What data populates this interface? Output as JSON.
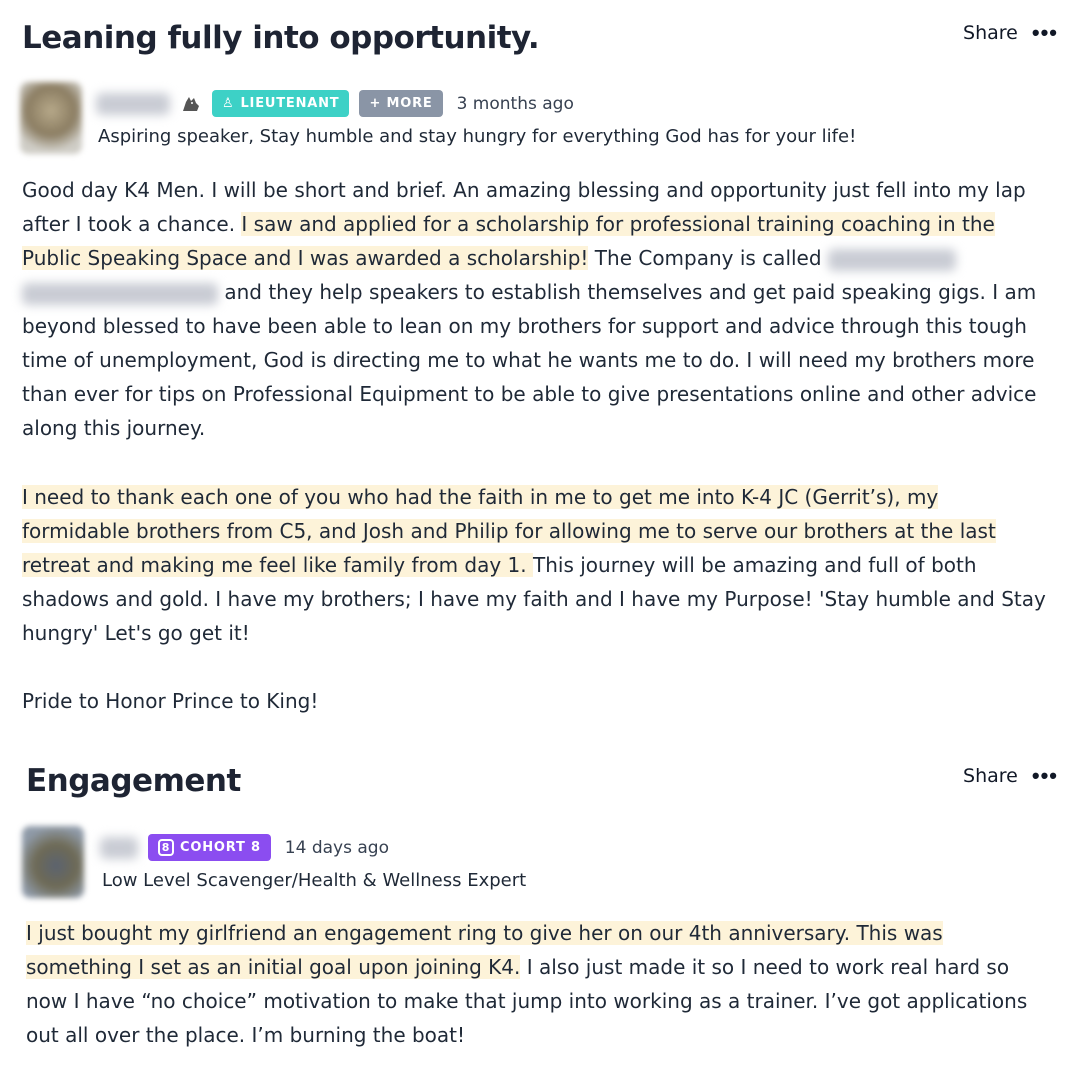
{
  "post1": {
    "title": "Leaning fully into opportunity.",
    "share_label": "Share",
    "more_label": "•••",
    "author": {
      "badge_primary": "LIEUTENANT",
      "badge_more": "+ MORE",
      "timestamp": "3 months ago",
      "tagline": "Aspiring speaker, Stay humble and stay hungry for everything God has for your life!"
    },
    "body": {
      "p1_a": "Good day K4 Men. I will be short and brief. An amazing blessing and opportunity just fell into my lap after I took a chance. ",
      "p1_hl": "I saw and applied for a scholarship for professional training coaching in the Public Speaking Space and I was awarded a scholarship!",
      "p1_b": " The Company is called ",
      "p1_c": " and they help speakers to establish themselves and get paid speaking gigs. I am beyond blessed to have been able to lean on my brothers for support and advice through this tough time of unemployment, God is directing me to what he wants me to do. I will need my brothers more than ever for tips on Professional Equipment to be able to give presentations online and other advice along this journey.",
      "p2_hl": " I need to thank each one of you who had the faith in me to get me into K-4 JC (Gerrit’s), my formidable brothers from C5, and Josh and Philip for allowing me to serve our brothers at the last retreat and making me feel like family from day 1.  ",
      "p2_b": " This journey will be amazing and full of both shadows and gold. I have my brothers; I have my faith and I have my Purpose!   'Stay humble and Stay hungry'  Let's go get it!",
      "p3": "Pride to Honor Prince to King!"
    }
  },
  "post2": {
    "title": "Engagement",
    "share_label": "Share",
    "more_label": "•••",
    "author": {
      "badge_primary": "COHORT 8",
      "badge_icon_text": "8",
      "timestamp": "14 days ago",
      "tagline": "Low Level Scavenger/Health & Wellness Expert"
    },
    "body": {
      "hl": "I just bought my girlfriend an engagement ring to give her on our 4th anniversary. This was something I set as an initial goal upon joining K4.",
      "rest": " I also just made it so I need to work real hard so now I have “no choice” motivation to make that jump into working as a trainer. I’ve got applications out all over the place. I’m burning the boat!"
    }
  },
  "colors": {
    "highlight": "#fdf3d9",
    "badge_cyan": "#3dd1c6",
    "badge_grey": "#8a95a6",
    "badge_purple": "#8b4df0"
  }
}
